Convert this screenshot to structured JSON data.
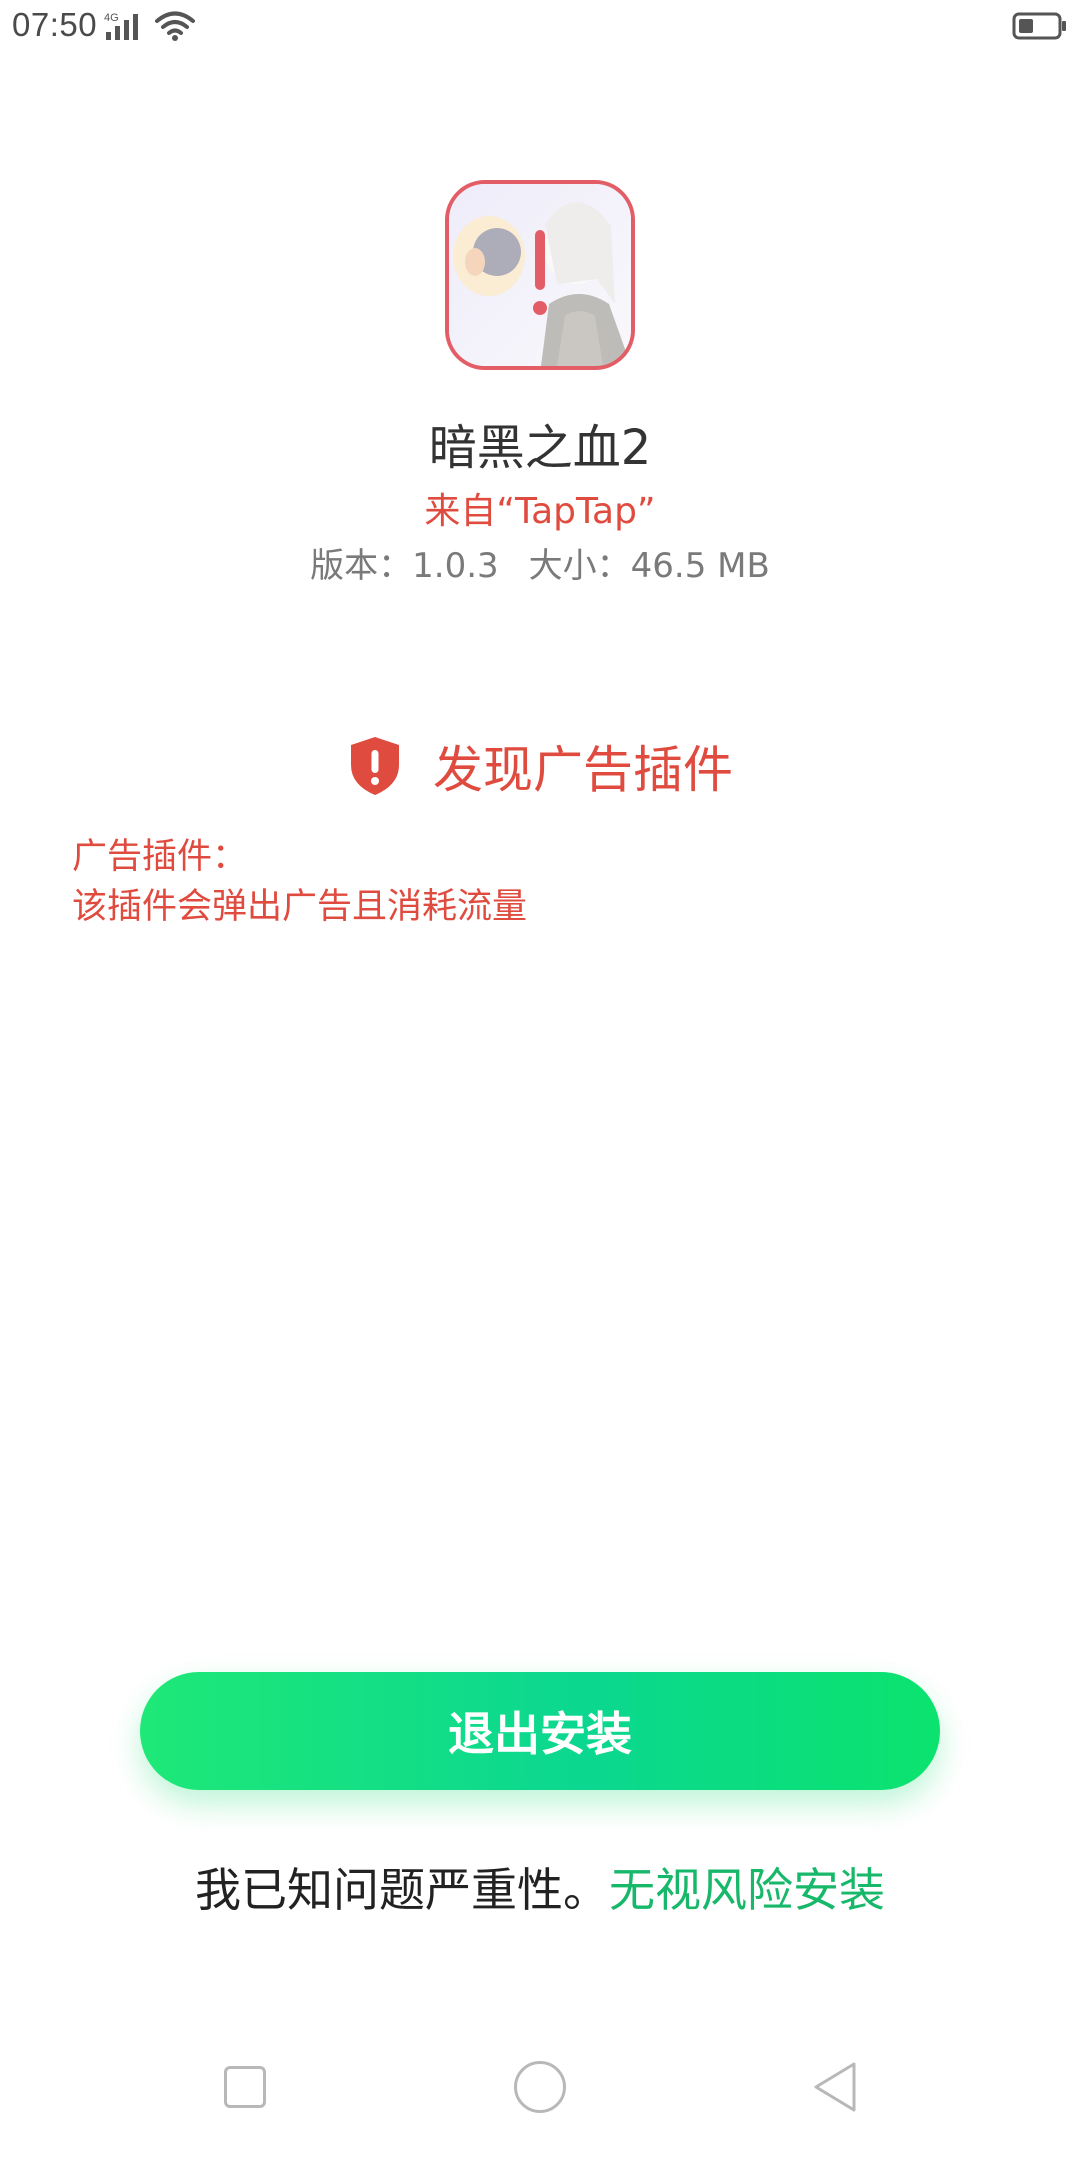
{
  "status_bar": {
    "time": "07:50",
    "network": "4G",
    "icons": [
      "signal-icon",
      "wifi-icon",
      "battery-icon"
    ]
  },
  "app": {
    "name": "暗黑之血2",
    "source": "来自“TapTap”",
    "version": "版本：1.0.3",
    "size": "大小：46.5 MB",
    "icon": "app-icon-with-warning-badge"
  },
  "warning": {
    "title": "发现广告插件",
    "icon": "shield-alert-icon",
    "detail_lines": [
      "广告插件：",
      "该插件会弹出广告且消耗流量"
    ]
  },
  "actions": {
    "exit_label": "退出安装",
    "ignore_prefix": "我已知问题严重性。",
    "ignore_link": "无视风险安装"
  },
  "nav_bar": {
    "icons": [
      "recent-apps-icon",
      "home-icon",
      "back-icon"
    ]
  },
  "colors": {
    "warning": "#e04b3f",
    "accent_green": "#12d37a",
    "link_green": "#17b86a",
    "icon_border": "#e35d67"
  }
}
